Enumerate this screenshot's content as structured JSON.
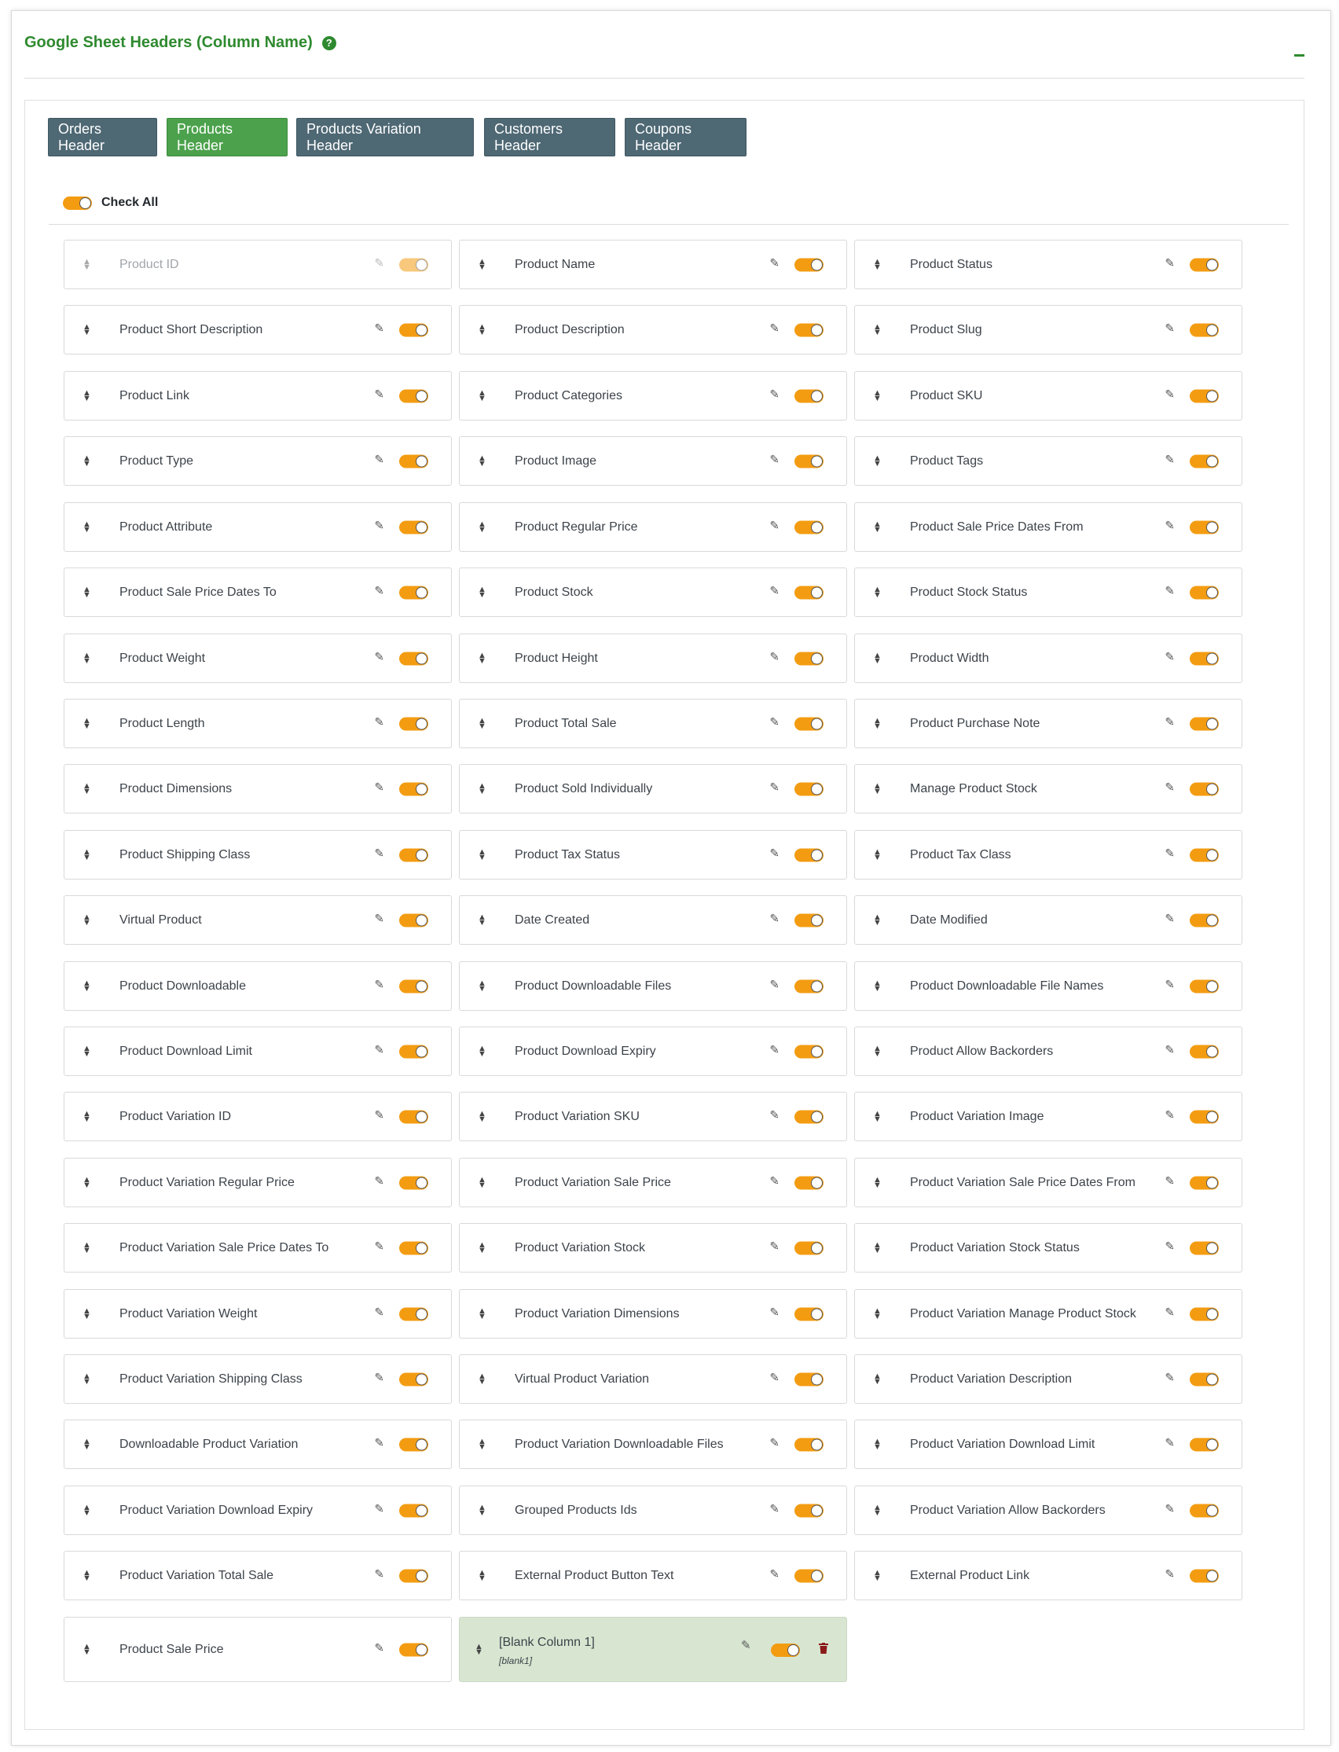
{
  "section": {
    "title": "Google Sheet Headers (Column Name)",
    "help_glyph": "?",
    "collapse_icon": "minus-icon"
  },
  "tabs": [
    {
      "label": "Orders Header",
      "active": false
    },
    {
      "label": "Products Header",
      "active": true
    },
    {
      "label": "Products Variation Header",
      "active": false
    },
    {
      "label": "Customers Header",
      "active": false
    },
    {
      "label": "Coupons Header",
      "active": false
    }
  ],
  "check_all": {
    "label": "Check All",
    "checked": true
  },
  "colors": {
    "accent_green": "#2f8a2f",
    "tab_active": "#4ca24c",
    "tab_inactive": "#4e6874",
    "toggle_on": "#f39c12",
    "blank_card_bg": "#d8e6d1"
  },
  "icons": {
    "drag": "sort-arrows-icon",
    "edit": "pencil-icon",
    "delete": "trash-icon"
  },
  "columns": [
    [
      "Product ID",
      "Product Short Description",
      "Product Link",
      "Product Type",
      "Product Attribute",
      "Product Sale Price Dates To",
      "Product Weight",
      "Product Length",
      "Product Dimensions",
      "Product Shipping Class",
      "Virtual Product",
      "Product Downloadable",
      "Product Download Limit",
      "Product Variation ID",
      "Product Variation Regular Price",
      "Product Variation Sale Price Dates To",
      "Product Variation Weight",
      "Product Variation Shipping Class",
      "Downloadable Product Variation",
      "Product Variation Download Expiry",
      "Product Variation Total Sale",
      "Product Sale Price"
    ],
    [
      "Product Name",
      "Product Description",
      "Product Categories",
      "Product Image",
      "Product Regular Price",
      "Product Stock",
      "Product Height",
      "Product Total Sale",
      "Product Sold Individually",
      "Product Tax Status",
      "Date Created",
      "Product Downloadable Files",
      "Product Download Expiry",
      "Product Variation SKU",
      "Product Variation Sale Price",
      "Product Variation Stock",
      "Product Variation Dimensions",
      "Virtual Product Variation",
      "Product Variation Downloadable Files",
      "Grouped Products Ids",
      "External Product Button Text"
    ],
    [
      "Product Status",
      "Product Slug",
      "Product SKU",
      "Product Tags",
      "Product Sale Price Dates From",
      "Product Stock Status",
      "Product Width",
      "Product Purchase Note",
      "Manage Product Stock",
      "Product Tax Class",
      "Date Modified",
      "Product Downloadable File Names",
      "Product Allow Backorders",
      "Product Variation Image",
      "Product Variation Sale Price Dates From",
      "Product Variation Stock Status",
      "Product Variation Manage Product Stock",
      "Product Variation Description",
      "Product Variation Download Limit",
      "Product Variation Allow Backorders",
      "External Product Link"
    ]
  ],
  "blank_column": {
    "label": "[Blank Column 1]",
    "key": "[blank1]",
    "enabled": true
  }
}
